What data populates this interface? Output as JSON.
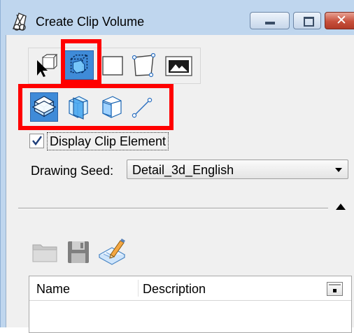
{
  "window": {
    "title": "Create Clip Volume",
    "icon": "clip-volume-app-icon",
    "controls": [
      "minimize-icon",
      "maximize-icon",
      "close-icon"
    ],
    "close_glyph": "✕"
  },
  "toolbar_method": {
    "items": [
      {
        "name": "select-element-tool",
        "icon": "arrow-cube-icon",
        "selected": false
      },
      {
        "name": "clip-by-volume-tool",
        "icon": "dotted-cube-icon",
        "selected": true
      },
      {
        "name": "clip-by-rectangle-tool",
        "icon": "rectangle-icon",
        "selected": false
      },
      {
        "name": "clip-by-shape-tool",
        "icon": "shape-points-icon",
        "selected": false
      },
      {
        "name": "clip-by-named-view-tool",
        "icon": "named-view-image-icon",
        "selected": false
      }
    ]
  },
  "toolbar_type": {
    "items": [
      {
        "name": "clip-plan-tool",
        "icon": "plan-volume-icon",
        "selected": true
      },
      {
        "name": "clip-elevation-tool",
        "icon": "elevation-volume-icon",
        "selected": false
      },
      {
        "name": "clip-section-tool",
        "icon": "section-volume-icon",
        "selected": false
      },
      {
        "name": "clip-by-line-tool",
        "icon": "line-icon",
        "selected": false
      }
    ]
  },
  "display_clip_element": {
    "label": "Display Clip Element",
    "checked": true
  },
  "drawing_seed": {
    "label": "Drawing Seed:",
    "value": "Detail_3d_English"
  },
  "toolbar_file": {
    "items": [
      {
        "name": "open-folder-button",
        "icon": "folder-icon",
        "enabled": false
      },
      {
        "name": "save-button",
        "icon": "floppy-disk-icon",
        "enabled": false
      },
      {
        "name": "edit-notes-button",
        "icon": "notepad-pencil-icon",
        "enabled": true
      }
    ]
  },
  "list": {
    "columns": [
      "Name",
      "Description"
    ],
    "rows": []
  },
  "colors": {
    "selected_tool": "#3f8bd8",
    "highlight": "#ff0000",
    "frame": "#bfd6ee"
  }
}
